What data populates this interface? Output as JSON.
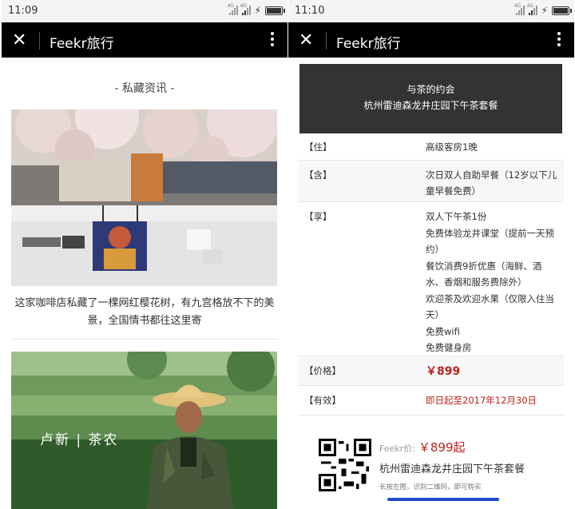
{
  "left": {
    "time": "11:09",
    "app_title": "Feekr旅行",
    "section_title": "- 私藏资讯 -",
    "caption": "这家咖啡店私藏了一棵网红樱花树，有九宫格放不下的美景，全国情书都往这里寄",
    "photo2_overlay": "卢新 | 茶农"
  },
  "right": {
    "time": "11:10",
    "app_title": "Feekr旅行",
    "banner_line1": "与茶的约会",
    "banner_line2": "杭州雷迪森龙井庄园下午茶套餐",
    "rows": [
      {
        "label": "【住】",
        "value": "高级客房1晚"
      },
      {
        "label": "【含】",
        "value": "次日双人自助早餐（12岁以下儿童早餐免费）"
      },
      {
        "label": "【享】",
        "value": "双人下午茶1份\n免费体验龙井课堂（提前一天预约）\n餐饮消费9折优惠（海鲜、酒水、香烟和服务费除外）\n欢迎茶及欢迎水果（仅限入住当天）\n免费wifi\n免费健身房"
      },
      {
        "label": "【价格】",
        "value": "￥899"
      },
      {
        "label": "【有效】",
        "value": "即日起至2017年12月30日"
      }
    ],
    "promo": {
      "price_label": "Feekr价:",
      "price": "￥899起",
      "name": "杭州雷迪森龙井庄园下午茶套餐",
      "hint": "长按左图，识别二维码，即可购买"
    }
  },
  "icons": {
    "close": "close-icon",
    "more": "more-vertical-icon",
    "signal": "signal-icon",
    "battery": "battery-icon",
    "charging": "lightning-icon"
  },
  "colors": {
    "accent_red": "#c0221b",
    "bar_blue": "#1f49c9",
    "titlebar": "#000000",
    "banner": "#333333"
  }
}
